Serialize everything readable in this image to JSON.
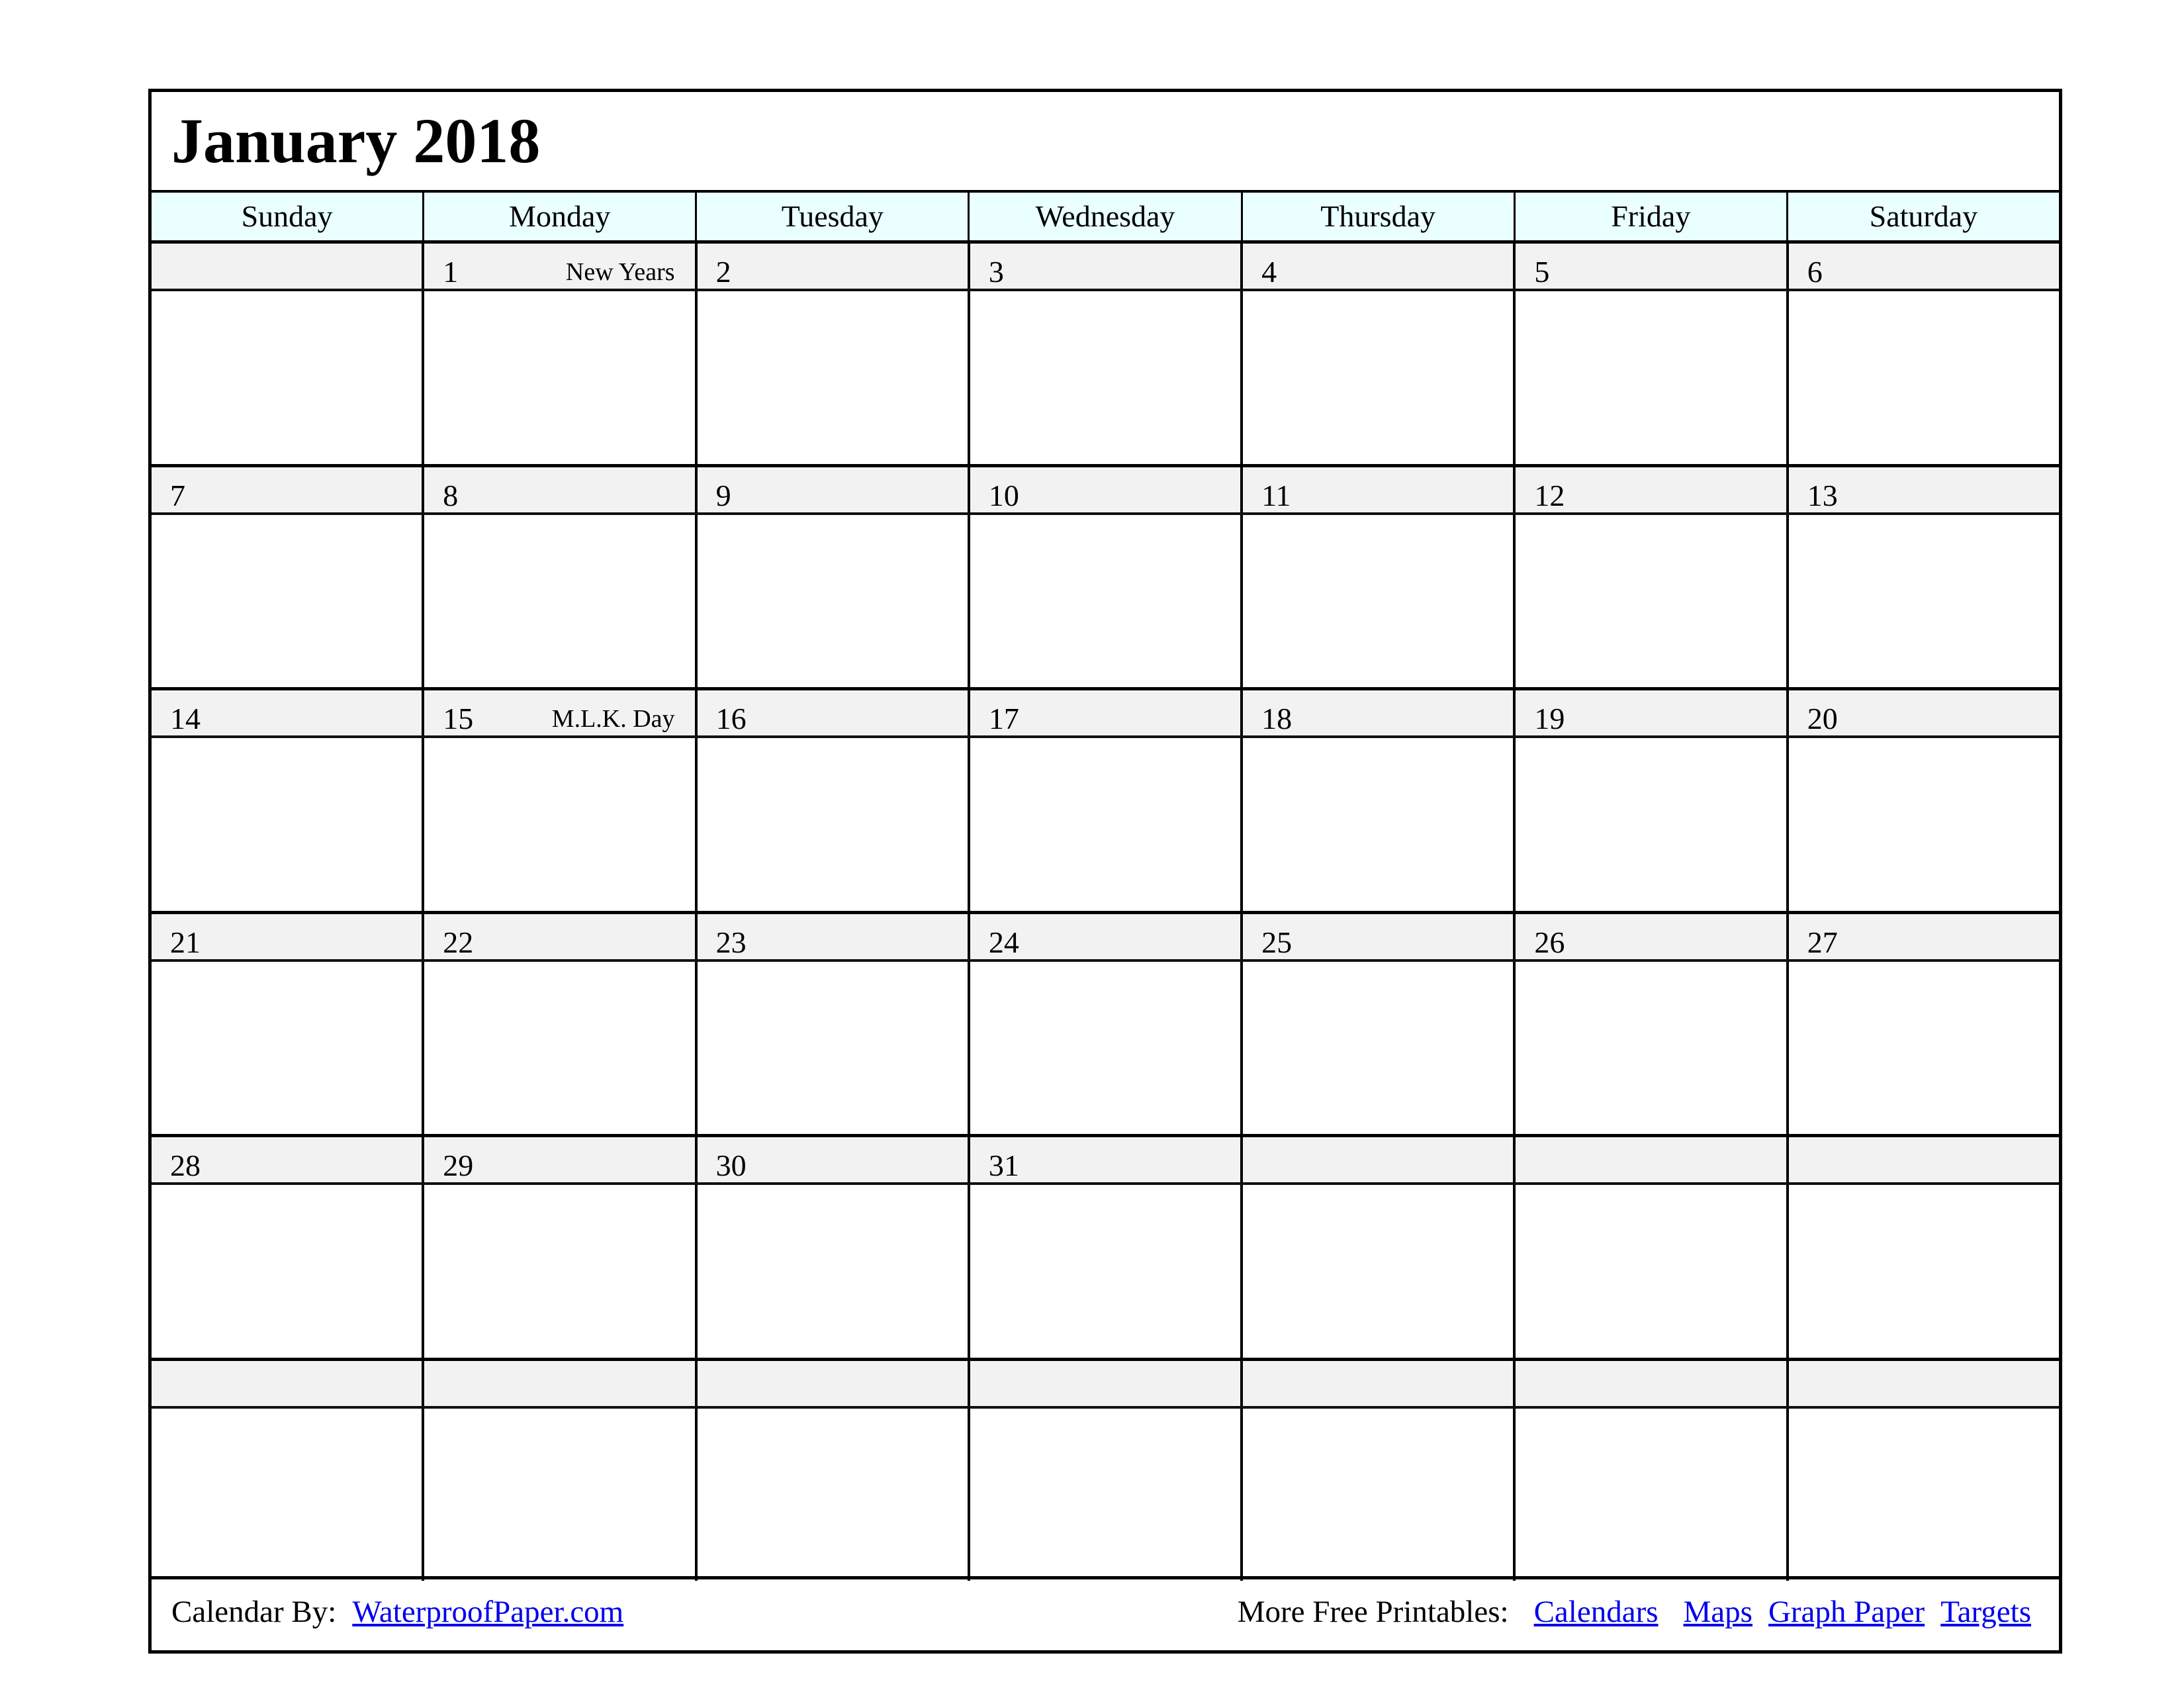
{
  "calendar": {
    "title": "January 2018",
    "weekdays": [
      "Sunday",
      "Monday",
      "Tuesday",
      "Wednesday",
      "Thursday",
      "Friday",
      "Saturday"
    ],
    "colors": {
      "header_bg": "#eaffff",
      "number_band_bg": "#f2f2f2",
      "link": "#0000ee"
    },
    "weeks": [
      [
        {
          "day": ""
        },
        {
          "day": "1",
          "holiday": "New Years"
        },
        {
          "day": "2"
        },
        {
          "day": "3"
        },
        {
          "day": "4"
        },
        {
          "day": "5"
        },
        {
          "day": "6"
        }
      ],
      [
        {
          "day": "7"
        },
        {
          "day": "8"
        },
        {
          "day": "9"
        },
        {
          "day": "10"
        },
        {
          "day": "11"
        },
        {
          "day": "12"
        },
        {
          "day": "13"
        }
      ],
      [
        {
          "day": "14"
        },
        {
          "day": "15",
          "holiday": "M.L.K. Day"
        },
        {
          "day": "16"
        },
        {
          "day": "17"
        },
        {
          "day": "18"
        },
        {
          "day": "19"
        },
        {
          "day": "20"
        }
      ],
      [
        {
          "day": "21"
        },
        {
          "day": "22"
        },
        {
          "day": "23"
        },
        {
          "day": "24"
        },
        {
          "day": "25"
        },
        {
          "day": "26"
        },
        {
          "day": "27"
        }
      ],
      [
        {
          "day": "28"
        },
        {
          "day": "29"
        },
        {
          "day": "30"
        },
        {
          "day": "31"
        },
        {
          "day": ""
        },
        {
          "day": ""
        },
        {
          "day": ""
        }
      ],
      [
        {
          "day": ""
        },
        {
          "day": ""
        },
        {
          "day": ""
        },
        {
          "day": ""
        },
        {
          "day": ""
        },
        {
          "day": ""
        },
        {
          "day": ""
        }
      ]
    ]
  },
  "footer": {
    "credit_label": "Calendar By:",
    "credit_link": "WaterproofPaper.com",
    "more_label": "More Free Printables:",
    "links": [
      "Calendars",
      "Maps",
      "Graph Paper",
      "Targets"
    ]
  }
}
